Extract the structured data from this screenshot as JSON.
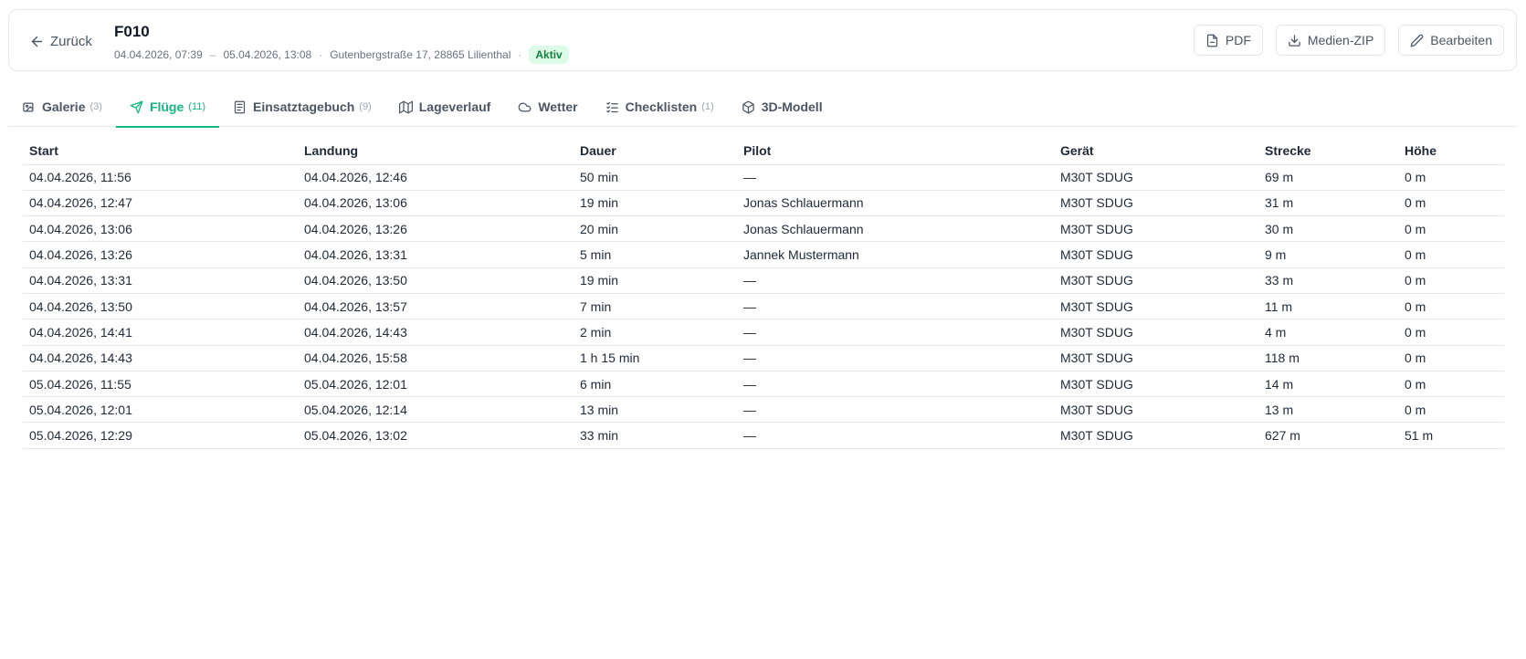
{
  "header": {
    "back_label": "Zurück",
    "title": "F010",
    "start_time": "04.04.2026, 07:39",
    "range_sep": "–",
    "end_time": "05.04.2026, 13:08",
    "meta_sep": "·",
    "address": "Gutenbergstraße 17, 28865 Lilienthal",
    "status": "Aktiv"
  },
  "actions": {
    "pdf_label": "PDF",
    "zip_label": "Medien-ZIP",
    "edit_label": "Bearbeiten"
  },
  "tabs": [
    {
      "label": "Galerie",
      "count": "(3)",
      "icon": "gallery-icon"
    },
    {
      "label": "Flüge",
      "count": "(11)",
      "icon": "send-icon",
      "active": true
    },
    {
      "label": "Einsatztagebuch",
      "count": "(9)",
      "icon": "notebook-icon"
    },
    {
      "label": "Lageverlauf",
      "count": "",
      "icon": "map-icon"
    },
    {
      "label": "Wetter",
      "count": "",
      "icon": "cloud-icon"
    },
    {
      "label": "Checklisten",
      "count": "(1)",
      "icon": "checklist-icon"
    },
    {
      "label": "3D-Modell",
      "count": "",
      "icon": "box-icon"
    }
  ],
  "table": {
    "columns": [
      "Start",
      "Landung",
      "Dauer",
      "Pilot",
      "Gerät",
      "Strecke",
      "Höhe"
    ],
    "rows": [
      [
        "04.04.2026, 11:56",
        "04.04.2026, 12:46",
        "50 min",
        "—",
        "M30T SDUG",
        "69 m",
        "0 m"
      ],
      [
        "04.04.2026, 12:47",
        "04.04.2026, 13:06",
        "19 min",
        "Jonas Schlauermann",
        "M30T SDUG",
        "31 m",
        "0 m"
      ],
      [
        "04.04.2026, 13:06",
        "04.04.2026, 13:26",
        "20 min",
        "Jonas Schlauermann",
        "M30T SDUG",
        "30 m",
        "0 m"
      ],
      [
        "04.04.2026, 13:26",
        "04.04.2026, 13:31",
        "5 min",
        "Jannek Mustermann",
        "M30T SDUG",
        "9 m",
        "0 m"
      ],
      [
        "04.04.2026, 13:31",
        "04.04.2026, 13:50",
        "19 min",
        "—",
        "M30T SDUG",
        "33 m",
        "0 m"
      ],
      [
        "04.04.2026, 13:50",
        "04.04.2026, 13:57",
        "7 min",
        "—",
        "M30T SDUG",
        "11 m",
        "0 m"
      ],
      [
        "04.04.2026, 14:41",
        "04.04.2026, 14:43",
        "2 min",
        "—",
        "M30T SDUG",
        "4 m",
        "0 m"
      ],
      [
        "04.04.2026, 14:43",
        "04.04.2026, 15:58",
        "1 h 15 min",
        "—",
        "M30T SDUG",
        "118 m",
        "0 m"
      ],
      [
        "05.04.2026, 11:55",
        "05.04.2026, 12:01",
        "6 min",
        "—",
        "M30T SDUG",
        "14 m",
        "0 m"
      ],
      [
        "05.04.2026, 12:01",
        "05.04.2026, 12:14",
        "13 min",
        "—",
        "M30T SDUG",
        "13 m",
        "0 m"
      ],
      [
        "05.04.2026, 12:29",
        "05.04.2026, 13:02",
        "33 min",
        "—",
        "M30T SDUG",
        "627 m",
        "51 m"
      ]
    ]
  },
  "colors": {
    "accent": "#10b981",
    "badge_bg": "#dcfce7",
    "badge_text": "#15803d",
    "border": "#e5e7eb"
  }
}
